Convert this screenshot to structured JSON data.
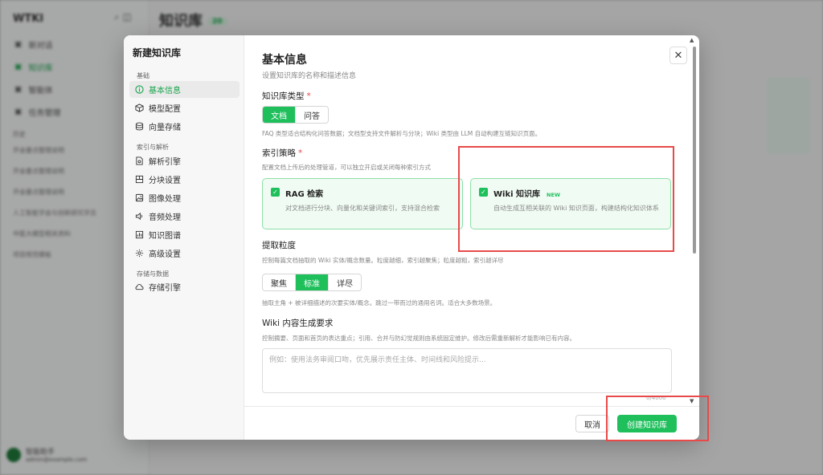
{
  "background": {
    "app_logo": "WTKI",
    "page_title": "知识库",
    "page_badge": "20",
    "nav": [
      "新对话",
      "知识库",
      "智能体",
      "任务管理"
    ],
    "history_label": "历史",
    "history": [
      "开会要点整理说明",
      "开会要点整理说明",
      "开会要点整理说明",
      "人工智能学会与创新研究学员",
      "中医大模型相关资料",
      "项目规范模板"
    ],
    "user_name": "智能助手",
    "user_email": "admin@example.com"
  },
  "modal": {
    "title": "新建知识库",
    "nav_groups": [
      {
        "label": "基础",
        "items": [
          {
            "label": "基本信息",
            "icon": "info-icon",
            "active": true
          },
          {
            "label": "模型配置",
            "icon": "cube-icon",
            "active": false
          },
          {
            "label": "向量存储",
            "icon": "database-icon",
            "active": false
          }
        ]
      },
      {
        "label": "索引与解析",
        "items": [
          {
            "label": "解析引擎",
            "icon": "file-scan-icon",
            "active": false
          },
          {
            "label": "分块设置",
            "icon": "split-icon",
            "active": false
          },
          {
            "label": "图像处理",
            "icon": "image-icon",
            "active": false
          },
          {
            "label": "音频处理",
            "icon": "audio-icon",
            "active": false
          },
          {
            "label": "知识图谱",
            "icon": "graph-icon",
            "active": false
          },
          {
            "label": "高级设置",
            "icon": "gear-icon",
            "active": false
          }
        ]
      },
      {
        "label": "存储与数据",
        "items": [
          {
            "label": "存储引擎",
            "icon": "cloud-icon",
            "active": false
          }
        ]
      }
    ],
    "section_title": "基本信息",
    "section_subtitle": "设置知识库的名称和描述信息",
    "kb_type": {
      "label": "知识库类型",
      "required": "*",
      "options": [
        "文档",
        "问答"
      ],
      "selected": "文档",
      "desc": "FAQ 类型适合结构化问答数据；文档型支持文件解析与分块；Wiki 类型由 LLM 自动构建互链知识页面。"
    },
    "index_strategy": {
      "label": "索引策略",
      "required": "*",
      "desc": "配置文档上传后的处理管道，可以独立开启或关闭每种索引方式",
      "cards": [
        {
          "title": "RAG 检索",
          "badge": "",
          "desc": "对文档进行分块、向量化和关键词索引，支持混合检索",
          "checked": true
        },
        {
          "title": "Wiki 知识库",
          "badge": "NEW",
          "desc": "自动生成互相关联的 Wiki 知识页面，构建结构化知识体系",
          "checked": true
        }
      ]
    },
    "granularity": {
      "label": "提取粒度",
      "desc": "控制每篇文档抽取的 Wiki 实体/概念数量。粒度越细，索引越聚焦；粒度越粗，索引越详尽",
      "options": [
        "聚焦",
        "标准",
        "详尽"
      ],
      "selected": "标准",
      "hint": "抽取主角 + 被详细描述的次要实体/概念。跳过一带而过的通用名词。适合大多数场景。"
    },
    "wiki_req": {
      "label": "Wiki 内容生成要求",
      "desc": "控制摘要、页面和首页的表达重点；引用、合并与防幻觉规则由系统固定维护。修改后需重新解析才能影响已有内容。",
      "placeholder": "例如：使用法务审阅口吻，优先展示责任主体、时间线和风险提示...",
      "value": "",
      "counter": "0/4000"
    },
    "footer": {
      "cancel": "取消",
      "create": "创建知识库"
    },
    "close_symbol": "✕",
    "accent": "#1fbf5c",
    "highlight": "#e84a4a"
  }
}
